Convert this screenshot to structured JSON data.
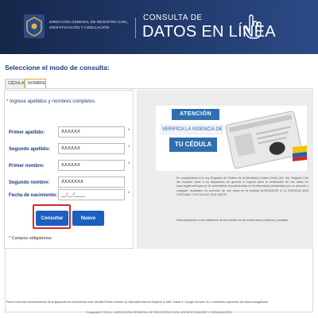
{
  "header": {
    "agency": "DIRECCIÓN GENERAL DE REGISTRO CIVIL, IDENTIFICACIÓN Y CEDULACIÓN",
    "consulta": "CONSULTA DE",
    "datos": "DATOS EN LÍNEA"
  },
  "mode": {
    "title": "Seleccione el modo de consulta:",
    "tabs": [
      "CÉDULA",
      "NOMBRE"
    ],
    "active_tab": "NOMBRE"
  },
  "form": {
    "title": "Ingrese apellidos y nombres completos",
    "fields": [
      {
        "label": "Primer apellido:",
        "value": "XXXXXX"
      },
      {
        "label": "Segundo apellido:",
        "value": "XXXXXX"
      },
      {
        "label": "Primer nombre:",
        "value": "XXXXXX"
      },
      {
        "label": "Segundo nombre:",
        "value": "XXXXXXX"
      },
      {
        "label": "Fecha de nacimiento:",
        "value": "__/__/____"
      }
    ],
    "consultar_label": "Consultar",
    "nuevo_label": "Nuevo",
    "campos": "Campos obligatorios"
  },
  "banner": {
    "atencion": "ATENCIÓN",
    "verifica": "VERIFICA LA VIGENCIA DE",
    "tu_cedula": "TU CÉDULA"
  },
  "info": {
    "paragraph1": "En cumplimiento a la Ley Orgánica de Gestión de la Identidad y Datos Civiles (Art. 92), Registro Civil del Ecuador pone a su disposición en general el ingreso para la verificación de sus datos en www.registrocivil.gob.ec de presentarse inconsistencias en la información presentada por su persona o cualquier ciudadano es acreedor de sus datos en la entidad ACÉRQUESE A LA AGENCIA MÁS CERCANA Y ACTUALICE SUS DATOS.",
    "paragraph2": "Esta disposición es la realización de los trámites en las instituciones públicas y privadas."
  },
  "footer": {
    "note": "Para el correcto funcionamiento de la aplicación se recomienda usar: Mozilla Firefox versión 16, Microsoft Internet Explorer 8, MAC Safari 5, Google Chrome 25, o versiones superiores de estos navegadores.",
    "copyright": "Copyright © 2014 - DIRECCIÓN GENERAL DE REGISTRO CIVIL, IDENTIFICACIÓN Y CEDULACIÓN"
  },
  "colors": {
    "header_dark": "#16264a",
    "accent_blue": "#1c5fbf",
    "highlight_red": "#d12a2a"
  }
}
